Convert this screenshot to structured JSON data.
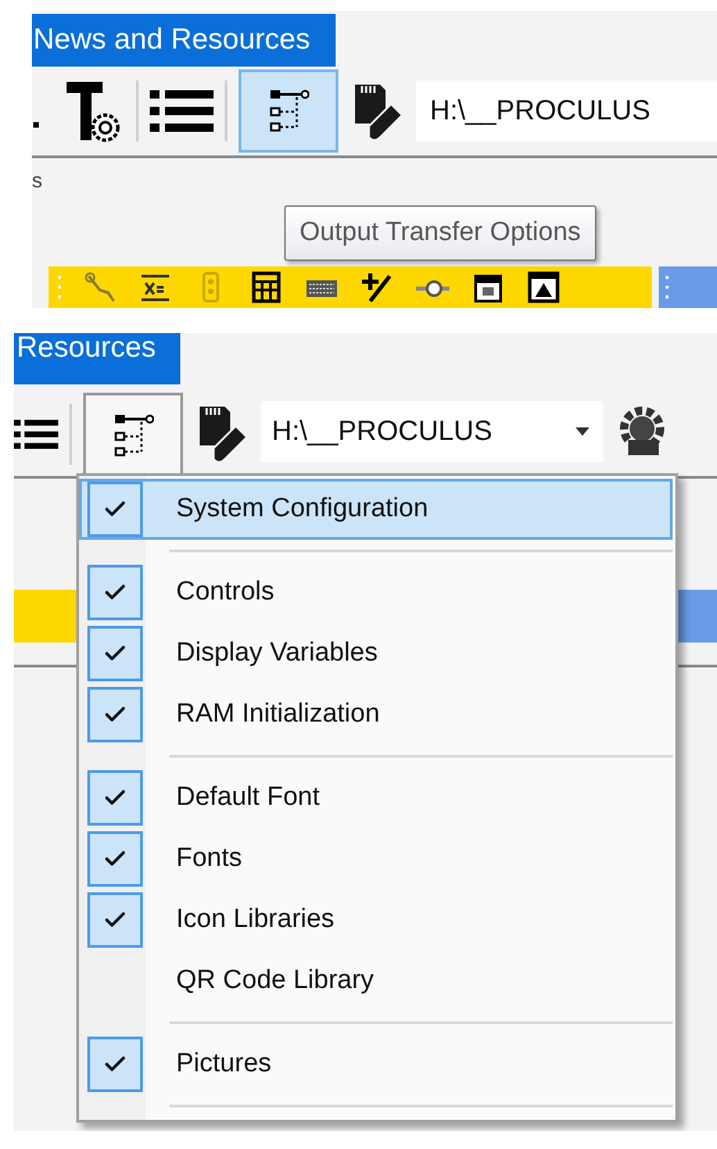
{
  "top_view": {
    "tab": "News and Resources",
    "options_button": {
      "selected": true,
      "expanded": false
    },
    "path": "H:\\__PROCULUS",
    "panel_label": "s",
    "tooltip": "Output Transfer Options"
  },
  "bottom_view": {
    "tab": "Resources",
    "options_button": {
      "selected": false,
      "expanded": true
    },
    "path": "H:\\__PROCULUS",
    "menu": [
      {
        "kind": "item",
        "label": "System Configuration",
        "checked": true,
        "selected": true
      },
      {
        "kind": "separator"
      },
      {
        "kind": "item",
        "label": "Controls",
        "checked": true,
        "selected": false
      },
      {
        "kind": "item",
        "label": "Display Variables",
        "checked": true,
        "selected": false
      },
      {
        "kind": "item",
        "label": "RAM Initialization",
        "checked": true,
        "selected": false
      },
      {
        "kind": "separator"
      },
      {
        "kind": "item",
        "label": "Default Font",
        "checked": true,
        "selected": false
      },
      {
        "kind": "item",
        "label": "Fonts",
        "checked": true,
        "selected": false
      },
      {
        "kind": "item",
        "label": "Icon Libraries",
        "checked": true,
        "selected": false
      },
      {
        "kind": "item",
        "label": "QR Code Library",
        "checked": false,
        "selected": false
      },
      {
        "kind": "separator"
      },
      {
        "kind": "item",
        "label": "Pictures",
        "checked": true,
        "selected": false
      },
      {
        "kind": "separator"
      }
    ]
  }
}
